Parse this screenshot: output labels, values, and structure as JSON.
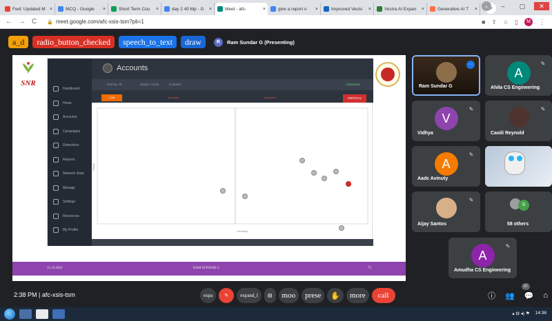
{
  "browser": {
    "tabs": [
      {
        "label": "Fwd: Updated M",
        "color": "#ea4335"
      },
      {
        "label": "MCQ - Google",
        "color": "#4285f4"
      },
      {
        "label": "Short Term Cou",
        "color": "#0f9d58"
      },
      {
        "label": "day 2 40 Mp - G",
        "color": "#4285f4"
      },
      {
        "label": "Meet - afc-",
        "color": "#00897b",
        "active": true
      },
      {
        "label": "give a report o",
        "color": "#4285f4"
      },
      {
        "label": "Improved Vecto",
        "color": "#1565c0"
      },
      {
        "label": "Vectra AI Expan",
        "color": "#2e7d32"
      },
      {
        "label": "Generative AI T",
        "color": "#ff7043"
      }
    ],
    "url": "meet.google.com/afc-xsis-tsm?pli=1"
  },
  "top_chips": {
    "chip1": "a_d",
    "chip2": "radio_button_checked",
    "chip3": "speech_to_text",
    "chip4": "draw",
    "presenter": "Ram Sundar G (Presenting)",
    "presenter_initial": "R"
  },
  "slide": {
    "logo_text": "SNR",
    "footer_left": "15.10.2024",
    "footer_center": "RAM SUNDAR G",
    "footer_right": "73",
    "dashboard": {
      "title": "Accounts",
      "sidebar": [
        "Dashboard",
        "Hosts",
        "Accounts",
        "Campaigns",
        "Detections",
        "Reports",
        "Network Stats",
        "Manage",
        "Settings",
        "Resources",
        "My Profile"
      ],
      "filter_1": "Sort by: All",
      "filter_2": "Status: Active",
      "filter_3": "Contains",
      "filter_adv": "Advanced",
      "low_label": "LOW",
      "critical_label": "CRITICAL",
      "q1_label": "Accounts",
      "q2_label": "Accounts",
      "x_label": "Certainty",
      "y_label": "Threat"
    }
  },
  "participants": [
    {
      "name": "Ram Sundar G",
      "type": "video"
    },
    {
      "name": "Ahila CS Engineering",
      "initial": "A",
      "color": "#00897b"
    },
    {
      "name": "Vidhya",
      "initial": "V",
      "color": "#8e44ad"
    },
    {
      "name": "Caoili Reynold",
      "type": "photo"
    },
    {
      "name": "Aadc Avinuty",
      "initial": "A",
      "color": "#f57c00"
    },
    {
      "name": "ai_Reader",
      "type": "robot"
    },
    {
      "name": "Aijay Santos",
      "type": "photo"
    },
    {
      "name": "58 others",
      "type": "others",
      "initial": "S"
    },
    {
      "name": "Amudha CS Engineering",
      "initial": "A",
      "color": "#8e24aa"
    }
  ],
  "bottom": {
    "time": "2:38 PM",
    "code": "afc-xsis-tsm",
    "ctl_expand1": "expa",
    "ctl_expand2": "expand_l",
    "ctl_mood": "moo",
    "ctl_present": "prese",
    "ctl_more": "more",
    "ctl_call": "call",
    "people_badge": "67"
  },
  "taskbar": {
    "clock": "14:38"
  }
}
